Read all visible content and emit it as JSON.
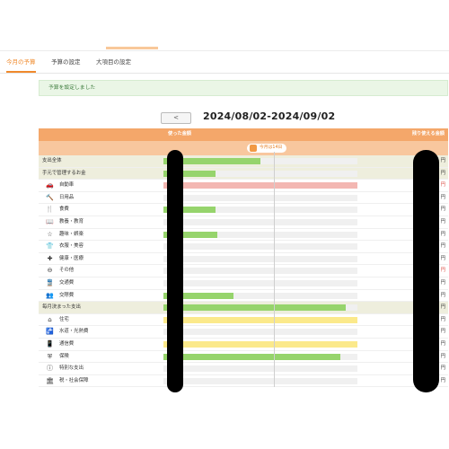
{
  "tabs": [
    {
      "label": "今月の予算",
      "active": true
    },
    {
      "label": "予算の設定",
      "active": false
    },
    {
      "label": "大項目の設定",
      "active": false
    }
  ],
  "notice": "予算を設定しました",
  "nav": {
    "prev_label": "<",
    "period": "2024/08/02-2024/09/02"
  },
  "table": {
    "spent_header": "使った金額",
    "remaining_header": "残り使える金額",
    "today_label": "今月は14日"
  },
  "colors": {
    "accent": "#f08a2c",
    "header": "#f4a76a",
    "over_budget": "#d9463e",
    "bar_ok": "#96d46c",
    "bar_over": "#f3b7b2",
    "bar_fixed": "#fbe98b"
  },
  "rows": [
    {
      "kind": "section",
      "label": "支出全体",
      "amount": "円",
      "remain": "円",
      "fill": 0.5,
      "color": "green"
    },
    {
      "kind": "section",
      "label": "手元で管理するお金",
      "amount": "円",
      "remain": "円",
      "fill": 0.27,
      "color": "green"
    },
    {
      "kind": "cat",
      "icon": "car-icon",
      "glyph": "🚗",
      "label": "自動車",
      "amount": "円",
      "remain": "円",
      "fill": 1.0,
      "color": "red",
      "over": true
    },
    {
      "kind": "cat",
      "icon": "daily-goods-icon",
      "glyph": "🔨",
      "label": "日用品",
      "amount": "",
      "remain": "円",
      "fill": 0.0,
      "color": "green"
    },
    {
      "kind": "cat",
      "icon": "food-icon",
      "glyph": "🍴",
      "label": "食費",
      "amount": "円",
      "remain": "円",
      "fill": 0.27,
      "color": "green"
    },
    {
      "kind": "cat",
      "icon": "education-icon",
      "glyph": "📖",
      "label": "教養・教育",
      "amount": "",
      "remain": "円",
      "fill": 0.0,
      "color": "green"
    },
    {
      "kind": "cat",
      "icon": "hobby-icon",
      "glyph": "☆",
      "label": "趣味・娯楽",
      "amount": "円",
      "remain": "円",
      "fill": 0.28,
      "color": "green"
    },
    {
      "kind": "cat",
      "icon": "clothing-icon",
      "glyph": "👕",
      "label": "衣服・美容",
      "amount": "",
      "remain": "円",
      "fill": 0.0,
      "color": "green"
    },
    {
      "kind": "cat",
      "icon": "health-icon",
      "glyph": "✚",
      "label": "健康・医療",
      "amount": "",
      "remain": "円",
      "fill": 0.0,
      "color": "green"
    },
    {
      "kind": "cat",
      "icon": "other-icon",
      "glyph": "⊖",
      "label": "その他",
      "amount": "円",
      "remain": "円",
      "fill": 0.0,
      "color": "green",
      "over": true
    },
    {
      "kind": "cat",
      "icon": "transport-icon",
      "glyph": "🚆",
      "label": "交通費",
      "amount": "",
      "remain": "円",
      "fill": 0.0,
      "color": "green"
    },
    {
      "kind": "cat",
      "icon": "social-icon",
      "glyph": "👥",
      "label": "交際費",
      "amount": "",
      "remain": "円",
      "fill": 0.36,
      "color": "green"
    },
    {
      "kind": "section",
      "label": "毎月決まった支出",
      "amount": "",
      "remain": "円",
      "fill": 0.94,
      "color": "green"
    },
    {
      "kind": "cat",
      "icon": "home-icon",
      "glyph": "⌂",
      "label": "住宅",
      "amount": "円",
      "remain": "円",
      "fill": 1.0,
      "color": "yellow"
    },
    {
      "kind": "cat",
      "icon": "utilities-icon",
      "glyph": "🚰",
      "label": "水道・光熱費",
      "amount": "円",
      "remain": "円",
      "fill": 0.0,
      "color": "green"
    },
    {
      "kind": "cat",
      "icon": "phone-icon",
      "glyph": "📱",
      "label": "通信費",
      "amount": "",
      "remain": "円",
      "fill": 1.0,
      "color": "yellow"
    },
    {
      "kind": "cat",
      "icon": "insurance-icon",
      "glyph": "⛨",
      "label": "保険",
      "amount": "",
      "remain": "円",
      "fill": 0.91,
      "color": "green"
    },
    {
      "kind": "cat",
      "icon": "special-expense-icon",
      "glyph": "ⓘ",
      "label": "特別な支出",
      "amount": "円",
      "remain": "円",
      "fill": 0.0,
      "color": "green"
    },
    {
      "kind": "cat",
      "icon": "tax-icon",
      "glyph": "🏛",
      "label": "税・社会保障",
      "amount": "",
      "remain": "円",
      "fill": 0.0,
      "color": "green"
    }
  ]
}
